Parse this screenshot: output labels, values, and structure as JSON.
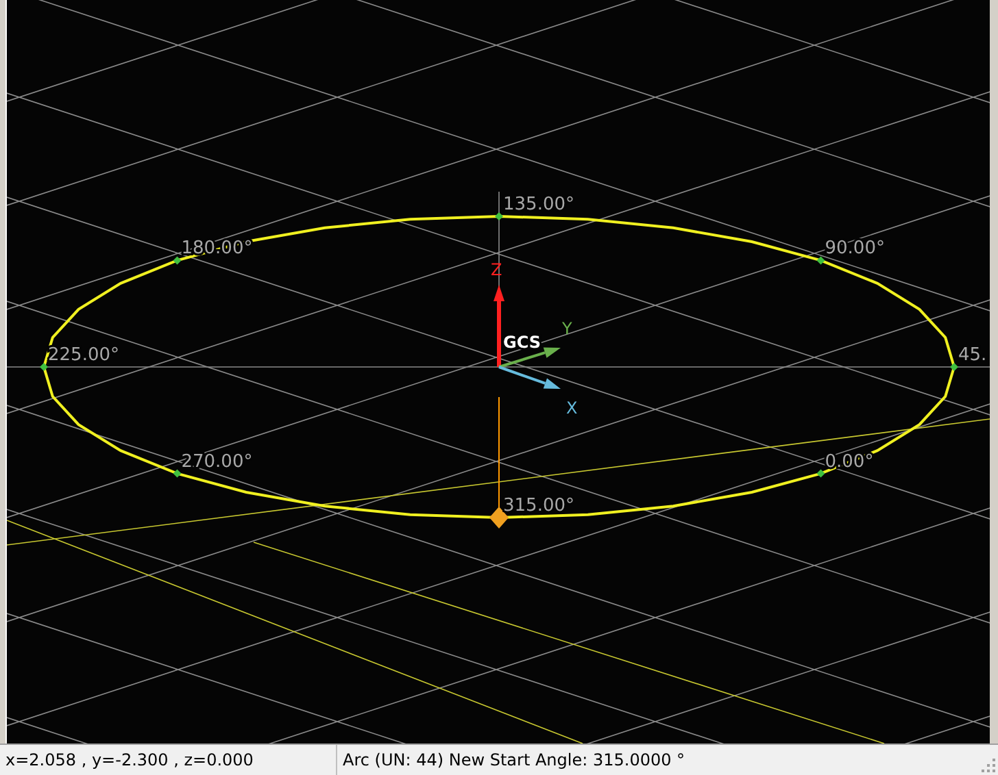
{
  "viewport": {
    "angle_labels": [
      {
        "text": "135.00°",
        "selected": false
      },
      {
        "text": "90.00°",
        "selected": false
      },
      {
        "text": "45.",
        "selected": false
      },
      {
        "text": "0.00°",
        "selected": false
      },
      {
        "text": "315.00°",
        "selected": true
      },
      {
        "text": "270.00°",
        "selected": false
      },
      {
        "text": "225.00°",
        "selected": false
      },
      {
        "text": "180.00°",
        "selected": false
      }
    ],
    "axes": [
      {
        "kind": "z",
        "label": "Z"
      },
      {
        "kind": "y",
        "label": "Y"
      },
      {
        "kind": "x",
        "label": "X"
      }
    ],
    "origin_label": "GCS"
  },
  "status_bar": {
    "coordinates": "x=2.058 , y=-2.300 , z=0.000",
    "message": "Arc (UN: 44) New Start Angle: 315.0000 °"
  }
}
